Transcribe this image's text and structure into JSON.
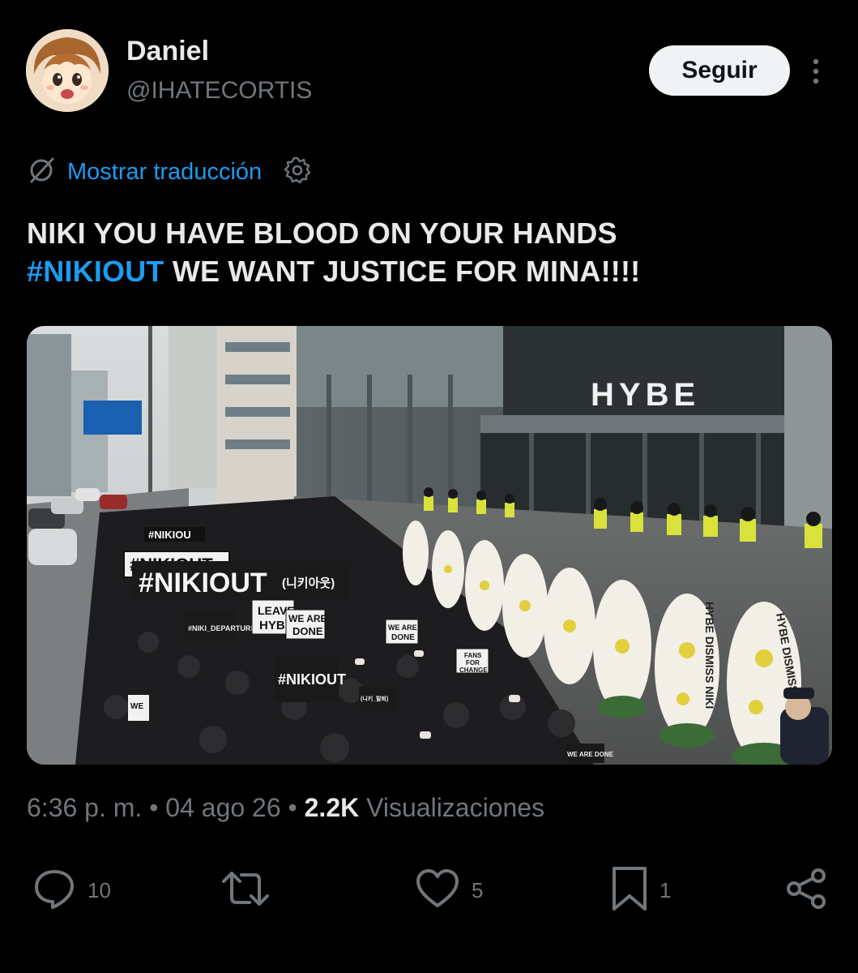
{
  "author": {
    "name": "Daniel",
    "handle": "@IHATECORTIS"
  },
  "follow_label": "Seguir",
  "translate": {
    "label": "Mostrar traducción"
  },
  "tweet": {
    "line1": "NIKI YOU HAVE BLOOD ON YOUR HANDS",
    "hashtag": "#NIKIOUT",
    "line2_rest": " WE WANT JUSTICE FOR MINA!!!!"
  },
  "media": {
    "building_sign": "HYBE",
    "signs": {
      "big_banner": "#NIKIOUT",
      "big_banner_korean": "(니키아웃)",
      "banner_small": "#NIKIOUT",
      "sign_top": "#NIKIOU",
      "sign_front": "#NIKIOUT",
      "leave_hybe_1": "LEAVE",
      "leave_hybe_2": "HYB",
      "we_are_done_1": "WE ARE",
      "we_are_done_2": "DONE",
      "we_are_done_3": "WE ARE",
      "we_are_done_4": "DONE",
      "fans_for_change_1": "FANS",
      "fans_for_change_2": "FOR",
      "fans_for_change_3": "CHANGE",
      "departure": "#NIKI_DEPARTURE",
      "departure_korean": "(니키_탈퇴)",
      "we_left": "WE",
      "we_are_done_bottom": "WE ARE DONE"
    },
    "wreath_ribbons": [
      "HYBE DISMISS NIKI",
      "HYBE DISMISS NIKI"
    ]
  },
  "meta": {
    "time": "6:36 p. m.",
    "separator": " • ",
    "date": "04 ago 26",
    "views_count": "2.2K",
    "views_label": " Visualizaciones"
  },
  "actions": {
    "replies": "10",
    "reposts": "",
    "likes": "5",
    "bookmarks": "1"
  },
  "colors": {
    "background": "#000000",
    "text_primary": "#e7e9ea",
    "text_secondary": "#71767b",
    "link": "#1d9bf0",
    "follow_button_bg": "#eff3f4"
  },
  "icons": [
    "translate-off-icon",
    "gear-icon",
    "more-dots-icon",
    "reply-icon",
    "repost-icon",
    "like-icon",
    "bookmark-icon",
    "share-icon"
  ]
}
